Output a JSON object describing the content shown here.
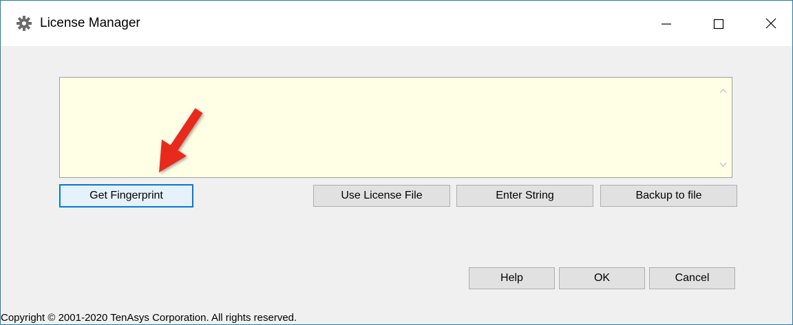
{
  "window": {
    "title": "License Manager",
    "app_icon": "gear-icon",
    "border_color": "#1a7fa8"
  },
  "caption_buttons": {
    "minimize_icon": "minimize-icon",
    "maximize_icon": "maximize-icon",
    "close_icon": "close-icon"
  },
  "license_text": {
    "value": "",
    "background": "#ffffe6"
  },
  "buttons": {
    "get_fingerprint": "Get Fingerprint",
    "use_license_file": "Use License File",
    "enter_string": "Enter String",
    "backup_to_file": "Backup to file",
    "help": "Help",
    "ok": "OK",
    "cancel": "Cancel"
  },
  "annotation": {
    "arrow_color": "#e8291c",
    "arrow_icon": "red-pointer-arrow-icon"
  },
  "footer": {
    "copyright": "Copyright © 2001-2020 TenAsys Corporation. All rights reserved."
  }
}
